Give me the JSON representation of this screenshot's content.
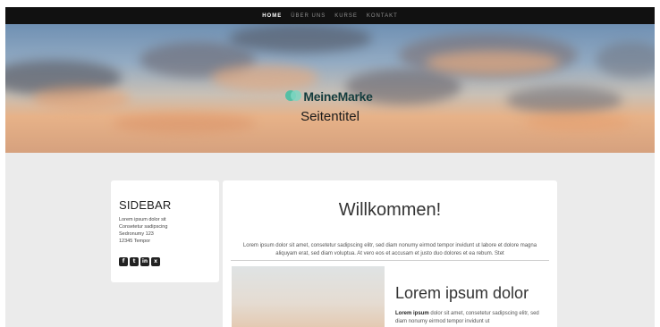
{
  "nav": {
    "items": [
      {
        "label": "HOME",
        "active": true
      },
      {
        "label": "ÜBER UNS",
        "active": false
      },
      {
        "label": "KURSE",
        "active": false
      },
      {
        "label": "KONTAKT",
        "active": false
      }
    ]
  },
  "hero": {
    "brand_name": "MeineMarke",
    "page_title": "Seitentitel"
  },
  "sidebar": {
    "title": "SIDEBAR",
    "lines": [
      "Lorem ipsum dolor sit",
      "Consetetur sadipscing",
      "Sedronumy 123",
      "12345 Tempor"
    ],
    "social_icons": [
      {
        "name": "facebook-icon",
        "glyph": "f"
      },
      {
        "name": "twitter-icon",
        "glyph": "t"
      },
      {
        "name": "linkedin-icon",
        "glyph": "in"
      },
      {
        "name": "xing-icon",
        "glyph": "x"
      }
    ]
  },
  "main": {
    "heading": "Willkommen!",
    "intro": "Lorem ipsum dolor sit amet, consetetur sadipscing elitr, sed diam nonumy eirmod tempor invidunt ut labore et dolore magna aliquyam erat, sed diam voluptua. At vero eos et accusam et justo duo dolores et ea rebum. Stet",
    "article": {
      "title": "Lorem ipsum dolor",
      "text_bold": "Lorem ipsum",
      "text_rest": " dolor sit amet, consetetur sadipscing elitr, sed diam nonumy eirmod tempor invidunt ut"
    }
  },
  "colors": {
    "nav_bg": "#111111",
    "page_bg": "#ebebeb",
    "brand_accent": "#3fbfa3"
  }
}
